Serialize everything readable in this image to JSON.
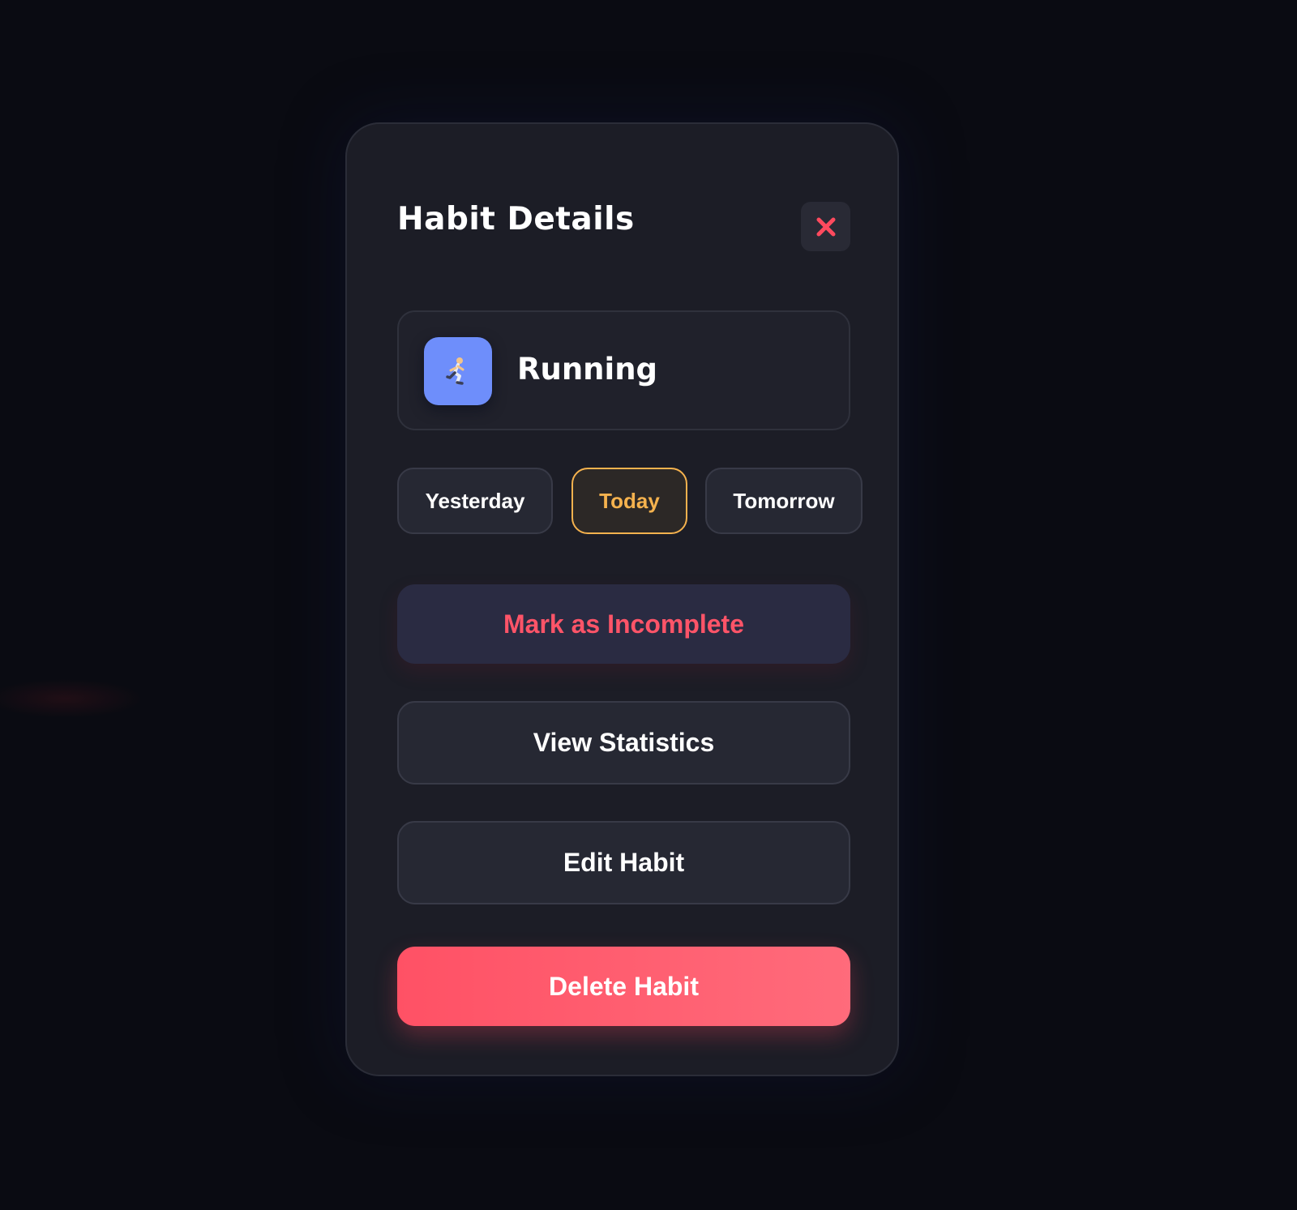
{
  "modal": {
    "title": "Habit Details",
    "close_icon": "close-x-icon"
  },
  "habit": {
    "name": "Running",
    "icon": "runner-emoji",
    "icon_glyph": "🏃",
    "icon_color": "#6e8efb"
  },
  "day_tabs": [
    {
      "label": "Yesterday",
      "active": false
    },
    {
      "label": "Today",
      "active": true
    },
    {
      "label": "Tomorrow",
      "active": false
    }
  ],
  "actions": {
    "mark_incomplete": "Mark as Incomplete",
    "view_statistics": "View Statistics",
    "edit_habit": "Edit Habit",
    "delete_habit": "Delete Habit"
  },
  "colors": {
    "accent_today": "#f5b24e",
    "danger": "#ff5468",
    "delete_gradient_start": "#ff5165",
    "delete_gradient_end": "#ff6b7b",
    "background": "#0a0b12",
    "modal_bg": "#1c1d26"
  }
}
